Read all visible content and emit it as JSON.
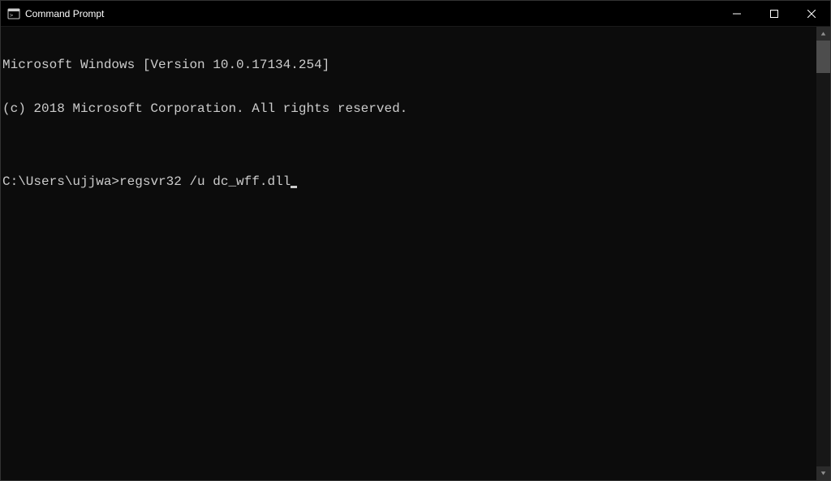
{
  "window": {
    "title": "Command Prompt"
  },
  "terminal": {
    "line1": "Microsoft Windows [Version 10.0.17134.254]",
    "line2": "(c) 2018 Microsoft Corporation. All rights reserved.",
    "blank": "",
    "prompt": "C:\\Users\\ujjwa>",
    "command": "regsvr32 /u dc_wff.dll"
  }
}
